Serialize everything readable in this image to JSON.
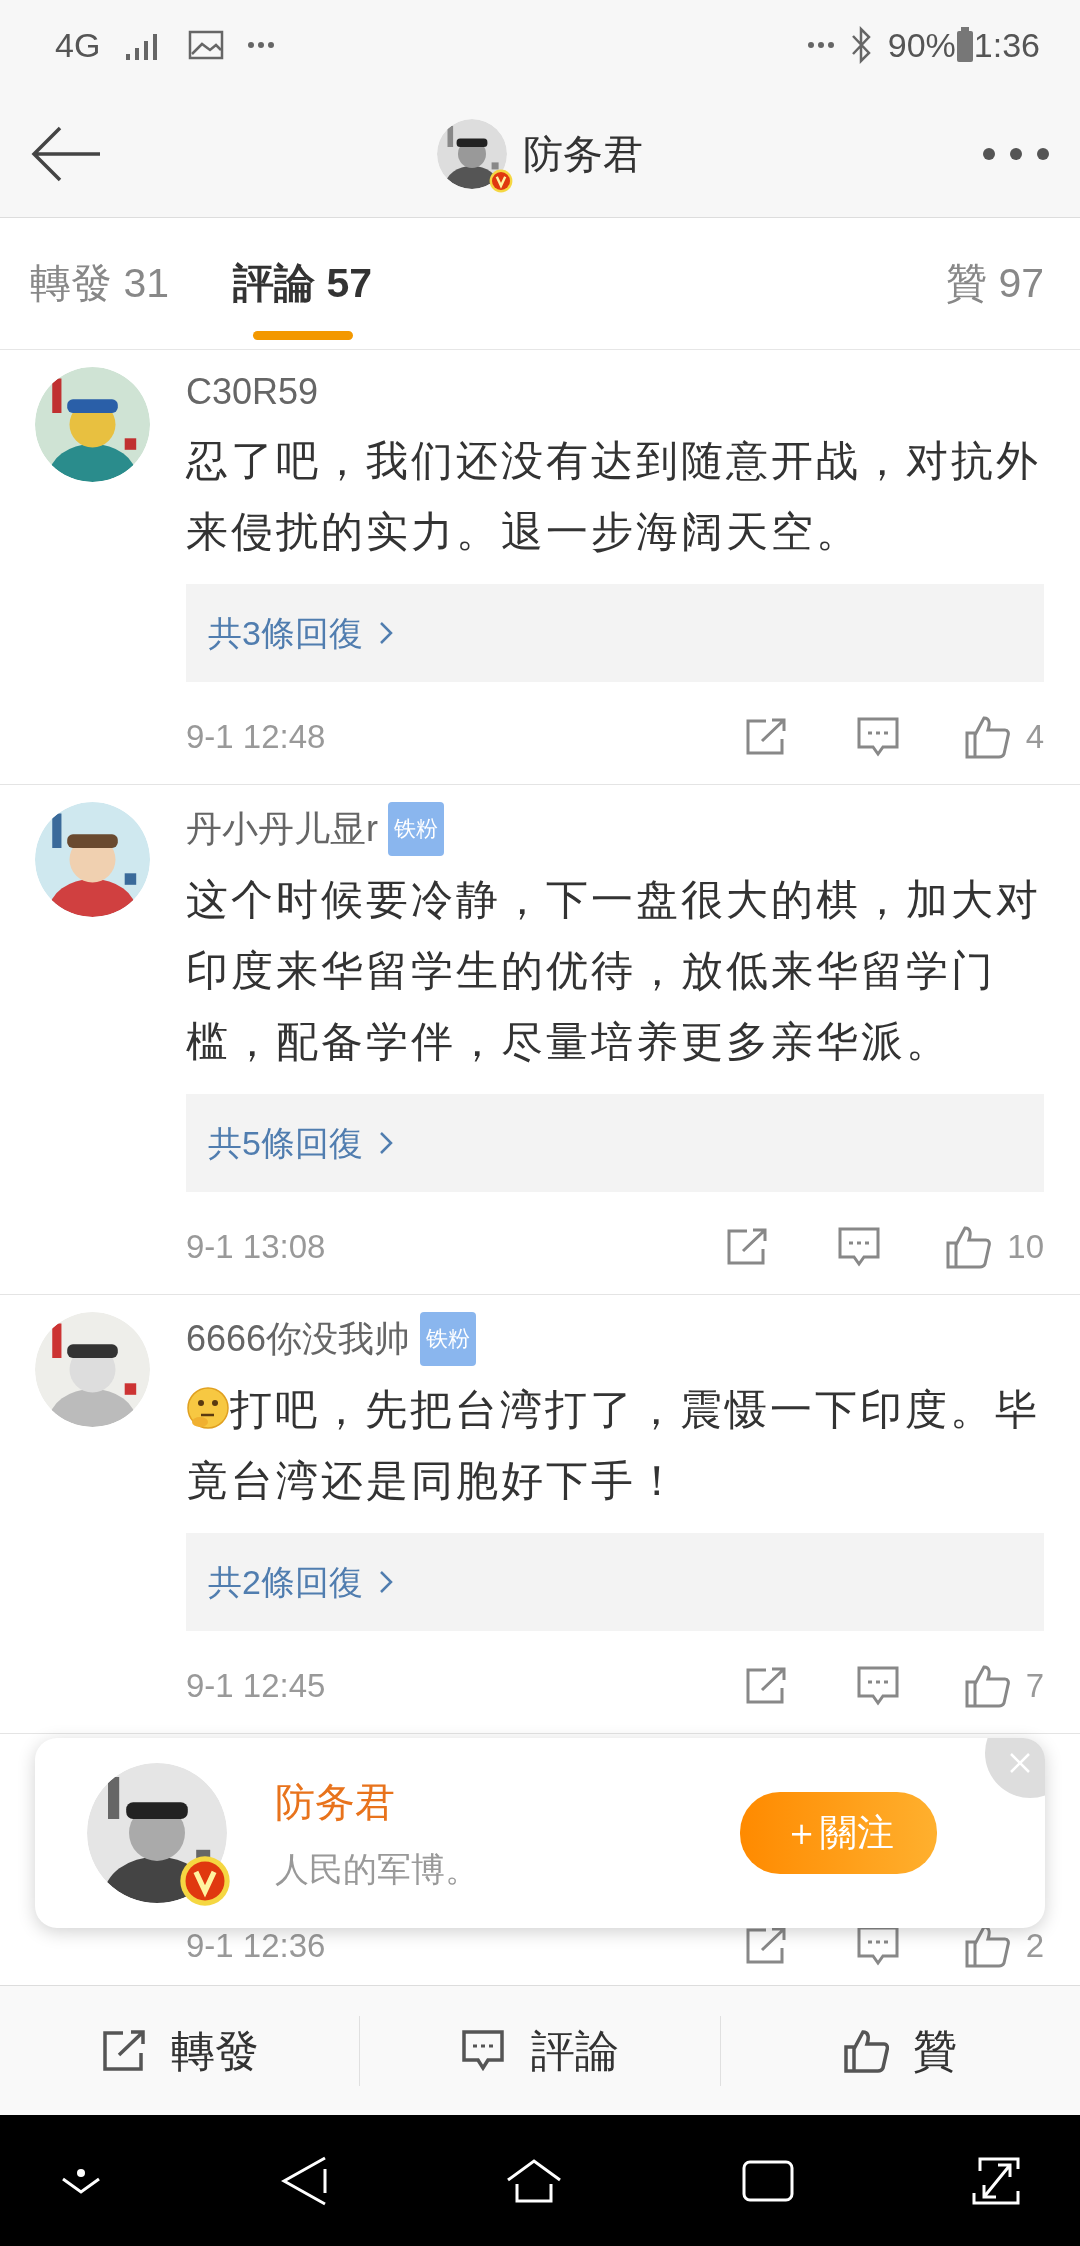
{
  "status_bar": {
    "network": "4G",
    "battery": "90%",
    "time": "1:36"
  },
  "header": {
    "title": "防务君",
    "verified": true
  },
  "tabs": [
    {
      "label": "轉發",
      "count": "31",
      "selected": false
    },
    {
      "label": "評論",
      "count": "57",
      "selected": true
    },
    {
      "label": "贊",
      "count": "97",
      "selected": false
    }
  ],
  "comments": [
    {
      "user": "C30R59",
      "leading_emoji": false,
      "content": "忍了吧，我们还没有达到随意开战，对抗外来侵扰的实力。退一步海阔天空。",
      "replies": "共3條回復",
      "time": "9-1 12:48",
      "likes": "4"
    },
    {
      "user": "丹小丹儿显r",
      "fan_badge": "铁粉",
      "leading_emoji": false,
      "content": "这个时候要冷静，下一盘很大的棋，加大对印度来华留学生的优待，放低来华留学门槛，配备学伴，尽量培养更多亲华派。",
      "replies": "共5條回復",
      "time": "9-1 13:08",
      "likes": "10"
    },
    {
      "user": "6666你没我帅",
      "fan_badge": "铁粉",
      "leading_emoji": true,
      "content": "打吧，先把台湾打了，震慑一下印度。毕竟台湾还是同胞好下手！",
      "replies": "共2條回復",
      "time": "9-1 12:45",
      "likes": "7"
    },
    {
      "time": "9-1 12:36",
      "likes": "2"
    }
  ],
  "follow_popup": {
    "name": "防务君",
    "bio": "人民的军博。",
    "verified": true,
    "button": "＋關注"
  },
  "bottom_bar": [
    {
      "kind": "repost",
      "label": "轉發"
    },
    {
      "kind": "comment",
      "label": "評論"
    },
    {
      "kind": "like",
      "label": "贊"
    }
  ]
}
